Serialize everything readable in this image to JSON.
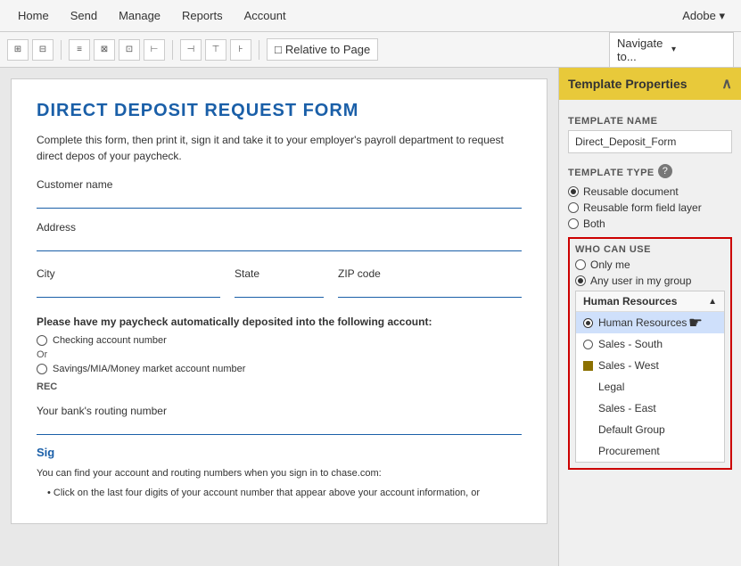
{
  "menubar": {
    "items": [
      "Home",
      "Send",
      "Manage",
      "Reports",
      "Account"
    ],
    "adobe_label": "Adobe ▾"
  },
  "toolbar": {
    "icons": [
      "⊞",
      "⊟",
      "⊠",
      "⊡",
      "⊢",
      "⊣",
      "⊤",
      "⊥",
      "⊦"
    ],
    "relative_page": "Relative to Page",
    "navigate_placeholder": "Navigate to...",
    "checkbox_icon": "□"
  },
  "document": {
    "title": "DIRECT DEPOSIT REQUEST FORM",
    "description": "Complete this form, then print it, sign it and take it to your employer's payroll department to request direct depos of your paycheck.",
    "fields": [
      {
        "label": "Customer name"
      },
      {
        "label": "Address"
      },
      {
        "label": "City",
        "label2": "State",
        "label3": "ZIP code"
      }
    ],
    "section_bold": "Please have my paycheck automatically deposited into the following account:",
    "radio_fields": [
      {
        "label": "Checking account number",
        "type": "radio"
      },
      {
        "or": "Or"
      },
      {
        "label": "Savings/MIA/Money market account number",
        "type": "radio"
      }
    ],
    "rec_label": "REC",
    "routing_label": "Your bank's routing number",
    "sig_label": "Sig",
    "footer": "You can find your account and routing numbers when you sign in to chase.com:",
    "bullet": "Click on the last four digits of your account number that appear above your account information, or"
  },
  "panel": {
    "header": "Template Properties",
    "collapse_icon": "∧",
    "template_name_label": "TEMPLATE NAME",
    "template_name_value": "Direct_Deposit_Form",
    "template_type_label": "TEMPLATE TYPE",
    "template_types": [
      {
        "label": "Reusable document",
        "selected": true
      },
      {
        "label": "Reusable form field layer",
        "selected": false
      },
      {
        "label": "Both",
        "selected": false
      }
    ],
    "who_can_use_label": "WHO CAN USE",
    "who_can_use_options": [
      {
        "label": "Only me",
        "selected": false
      },
      {
        "label": "Any user in my group",
        "selected": true
      }
    ],
    "group_header": "Human Resources",
    "group_list": [
      {
        "label": "Human Resources",
        "highlighted": true,
        "radio": true
      },
      {
        "label": "Sales - South",
        "highlighted": false,
        "radio": false,
        "filled_square": false
      },
      {
        "label": "Sales - West",
        "highlighted": false,
        "radio": false,
        "filled_square": true
      },
      {
        "label": "Legal",
        "highlighted": false
      },
      {
        "label": "Sales - East",
        "highlighted": false
      },
      {
        "label": "Default Group",
        "highlighted": false
      },
      {
        "label": "Procurement",
        "highlighted": false
      }
    ]
  }
}
